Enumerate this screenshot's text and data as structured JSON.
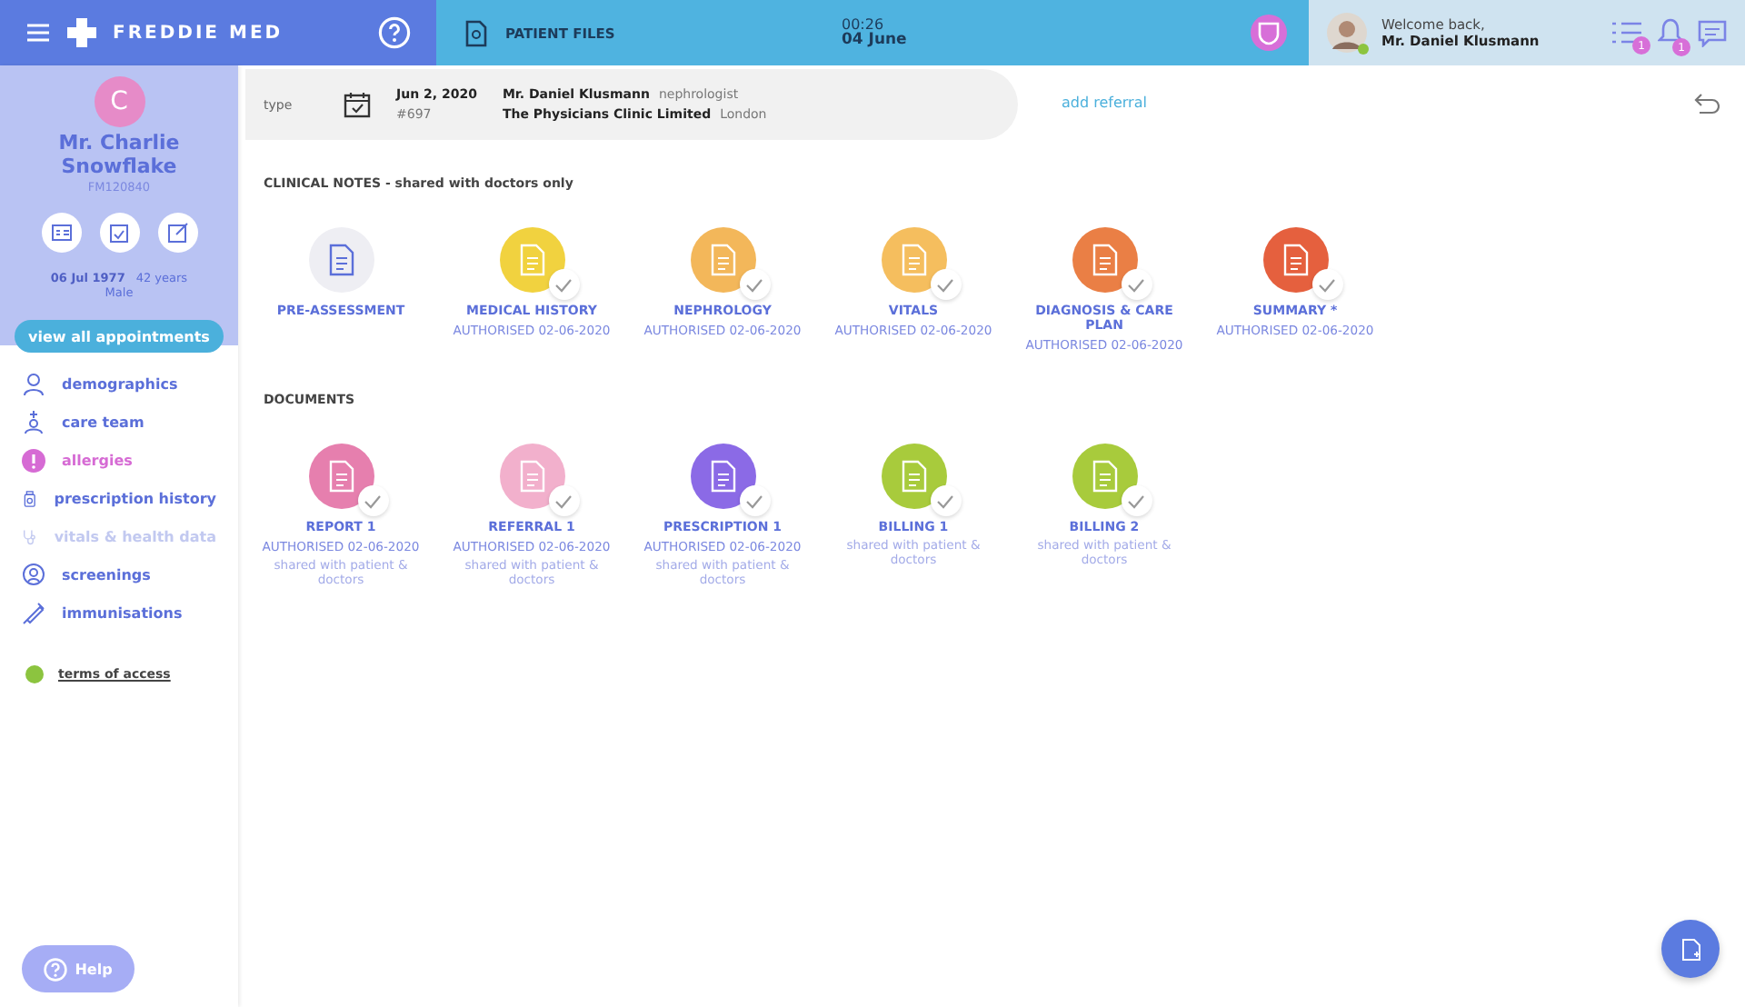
{
  "header": {
    "logo": "FREDDIE MED",
    "section": "PATIENT FILES",
    "time": "00:26",
    "date": "04 June",
    "welcome": "Welcome back,",
    "user": "Mr. Daniel Klusmann",
    "online": true,
    "task_count": "1",
    "alert_count": "1"
  },
  "patient": {
    "initial": "C",
    "name": "Mr. Charlie Snowflake",
    "id": "FM120840",
    "dob": "06 Jul 1977",
    "age": "42 years",
    "sex": "Male"
  },
  "appointments_button": "view all appointments",
  "nav": [
    {
      "label": "demographics",
      "alert": false,
      "disabled": false
    },
    {
      "label": "care team",
      "alert": false,
      "disabled": false
    },
    {
      "label": "allergies",
      "alert": true,
      "disabled": false
    },
    {
      "label": "prescription history",
      "alert": false,
      "disabled": false
    },
    {
      "label": "vitals & health data",
      "alert": false,
      "disabled": true
    },
    {
      "label": "screenings",
      "alert": false,
      "disabled": false
    },
    {
      "label": "immunisations",
      "alert": false,
      "disabled": false
    }
  ],
  "terms": {
    "label": "terms of access",
    "color": "#8cc43f"
  },
  "help_button": "Help",
  "referral": {
    "type_label": "type",
    "date": "Jun 2, 2020",
    "number": "#697",
    "doctor": "Mr. Daniel Klusmann",
    "specialty": "nephrologist",
    "clinic": "The Physicians Clinic Limited",
    "city": "London",
    "add_link": "add referral"
  },
  "sections": [
    {
      "title": "CLINICAL NOTES - shared with doctors only",
      "items": [
        {
          "label": "PRE-ASSESSMENT",
          "color": "#eeeef3",
          "checked": false
        },
        {
          "label": "MEDICAL HISTORY",
          "color": "#f1d23f",
          "checked": true,
          "status": "AUTHORISED 02-06-2020"
        },
        {
          "label": "NEPHROLOGY",
          "color": "#f3b75a",
          "checked": true,
          "status": "AUTHORISED 02-06-2020"
        },
        {
          "label": "VITALS",
          "color": "#f5be5e",
          "checked": true,
          "status": "AUTHORISED 02-06-2020"
        },
        {
          "label": "DIAGNOSIS & CARE PLAN",
          "color": "#ea7f45",
          "checked": true,
          "status": "AUTHORISED 02-06-2020"
        },
        {
          "label": "SUMMARY *",
          "color": "#e5603e",
          "checked": true,
          "status": "AUTHORISED 02-06-2020"
        }
      ]
    },
    {
      "title": "DOCUMENTS",
      "items": [
        {
          "label": "REPORT 1",
          "color": "#e67fae",
          "checked": true,
          "status": "AUTHORISED 02-06-2020",
          "note": "shared with patient & doctors"
        },
        {
          "label": "REFERRAL 1",
          "color": "#f2b0cc",
          "checked": true,
          "status": "AUTHORISED 02-06-2020",
          "note": "shared with patient & doctors"
        },
        {
          "label": "PRESCRIPTION 1",
          "color": "#8b6ae6",
          "checked": true,
          "status": "AUTHORISED 02-06-2020",
          "note": "shared with patient & doctors"
        },
        {
          "label": "BILLING 1",
          "color": "#a8cb3c",
          "checked": true,
          "note": "shared with patient & doctors"
        },
        {
          "label": "BILLING 2",
          "color": "#a8cb3c",
          "checked": true,
          "note": "shared with patient & doctors"
        }
      ]
    }
  ]
}
